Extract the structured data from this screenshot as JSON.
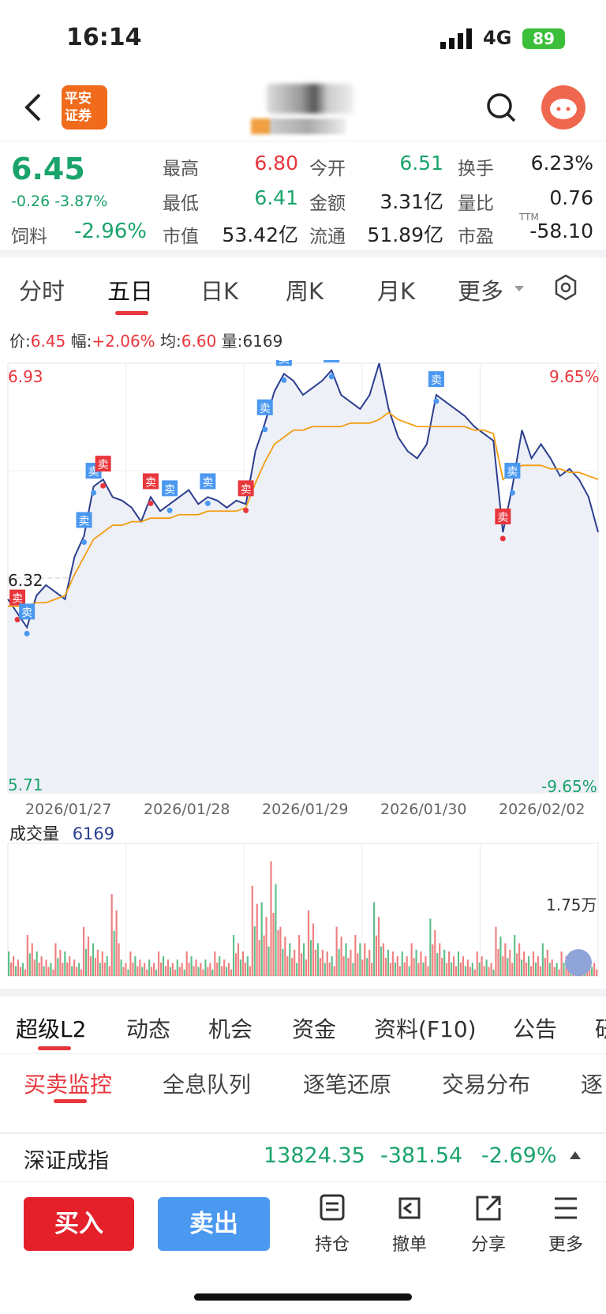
{
  "status_bar": {
    "time": "16:14",
    "network": "4G",
    "battery": "89"
  },
  "header": {
    "logo_line1": "平安",
    "logo_line2": "证券"
  },
  "quote": {
    "price": "6.45",
    "change": "-0.26 -3.87%",
    "sector_name": "饲料",
    "sector_change": "-2.96%",
    "stats": [
      {
        "label": "最高",
        "value": "6.80",
        "color": "#e8363c"
      },
      {
        "label": "今开",
        "value": "6.51",
        "color": "#1aa36b"
      },
      {
        "label": "换手",
        "value": "6.23%",
        "color": "#222222"
      },
      {
        "label": "最低",
        "value": "6.41",
        "color": "#1aa36b"
      },
      {
        "label": "金额",
        "value": "3.31亿",
        "color": "#222222"
      },
      {
        "label": "量比",
        "value": "0.76",
        "color": "#222222"
      },
      {
        "label": "市值",
        "value": "53.42亿",
        "color": "#222222"
      },
      {
        "label": "流通",
        "value": "51.89亿",
        "color": "#222222"
      },
      {
        "label": "市盈",
        "value": "-58.10",
        "color": "#222222"
      }
    ],
    "pe_sup": "TTM"
  },
  "chart_tabs": [
    "分时",
    "五日",
    "日K",
    "周K",
    "月K",
    "更多"
  ],
  "chart_info": {
    "price_label": "价:",
    "price": "6.45",
    "amp_label": "幅:",
    "amp": "+2.06%",
    "avg_label": "均:",
    "avg": "6.60",
    "vol_label": "量:",
    "vol": "6169"
  },
  "chart_axis": {
    "top_price": "6.93",
    "mid_price": "6.32",
    "bottom_price": "5.71",
    "top_pct": "9.65%",
    "bottom_pct": "-9.65%"
  },
  "volume": {
    "title": "成交量",
    "value": "6169",
    "scale": "1.75万"
  },
  "trade_label": "卖",
  "chart_data": {
    "type": "line",
    "x_dates": [
      "2026/01/27",
      "2026/01/28",
      "2026/01/29",
      "2026/01/30",
      "2026/02/02"
    ],
    "ylim": [
      5.71,
      6.93
    ],
    "series": [
      {
        "name": "价",
        "color": "#2c3e8f",
        "values": [
          6.26,
          6.22,
          6.18,
          6.27,
          6.3,
          6.28,
          6.26,
          6.38,
          6.44,
          6.58,
          6.6,
          6.55,
          6.54,
          6.52,
          6.48,
          6.55,
          6.51,
          6.53,
          6.55,
          6.57,
          6.53,
          6.55,
          6.54,
          6.52,
          6.54,
          6.53,
          6.68,
          6.76,
          6.85,
          6.9,
          6.88,
          6.84,
          6.86,
          6.88,
          6.91,
          6.84,
          6.82,
          6.8,
          6.84,
          6.93,
          6.8,
          6.72,
          6.68,
          6.66,
          6.7,
          6.84,
          6.82,
          6.8,
          6.78,
          6.75,
          6.73,
          6.71,
          6.45,
          6.58,
          6.74,
          6.66,
          6.7,
          6.66,
          6.61,
          6.63,
          6.6,
          6.55,
          6.45
        ]
      },
      {
        "name": "均",
        "color": "#f39c12",
        "values": [
          6.24,
          6.24,
          6.24,
          6.25,
          6.25,
          6.26,
          6.27,
          6.33,
          6.38,
          6.43,
          6.45,
          6.47,
          6.47,
          6.48,
          6.48,
          6.49,
          6.49,
          6.49,
          6.5,
          6.5,
          6.5,
          6.51,
          6.51,
          6.51,
          6.51,
          6.52,
          6.59,
          6.65,
          6.7,
          6.72,
          6.74,
          6.74,
          6.75,
          6.75,
          6.75,
          6.75,
          6.76,
          6.76,
          6.76,
          6.77,
          6.79,
          6.77,
          6.76,
          6.75,
          6.75,
          6.75,
          6.75,
          6.75,
          6.75,
          6.74,
          6.74,
          6.73,
          6.6,
          6.62,
          6.64,
          6.64,
          6.64,
          6.63,
          6.63,
          6.62,
          6.62,
          6.61,
          6.6
        ]
      }
    ],
    "volume_values": [
      3,
      2,
      5,
      3,
      2,
      4,
      3,
      2,
      6,
      4,
      3,
      10,
      2,
      3,
      2,
      2,
      3,
      2,
      2,
      3,
      2,
      2,
      3,
      2,
      5,
      3,
      11,
      9,
      14,
      6,
      4,
      5,
      8,
      4,
      3,
      6,
      4,
      5,
      4,
      9,
      4,
      3,
      3,
      4,
      3,
      7,
      4,
      3,
      3,
      2,
      3,
      2,
      6,
      4,
      5,
      3,
      3,
      4,
      2,
      3,
      3,
      2,
      2
    ],
    "volume_max": 17500
  },
  "bottom_tabs": [
    "超级L2",
    "动态",
    "机会",
    "资金",
    "资料(F10)",
    "公告",
    "研"
  ],
  "sub_tabs": [
    "买卖监控",
    "全息队列",
    "逐笔还原",
    "交易分布",
    "逐"
  ],
  "index_bar": {
    "name": "深证成指",
    "value": "13824.35",
    "change": "-381.54",
    "pct": "-2.69%"
  },
  "actions": {
    "buy": "买入",
    "sell": "卖出"
  },
  "toolbar": [
    {
      "label": "持仓",
      "icon": "holdings-icon"
    },
    {
      "label": "撤单",
      "icon": "cancel-order-icon"
    },
    {
      "label": "分享",
      "icon": "share-icon"
    },
    {
      "label": "更多",
      "icon": "more-icon"
    }
  ]
}
